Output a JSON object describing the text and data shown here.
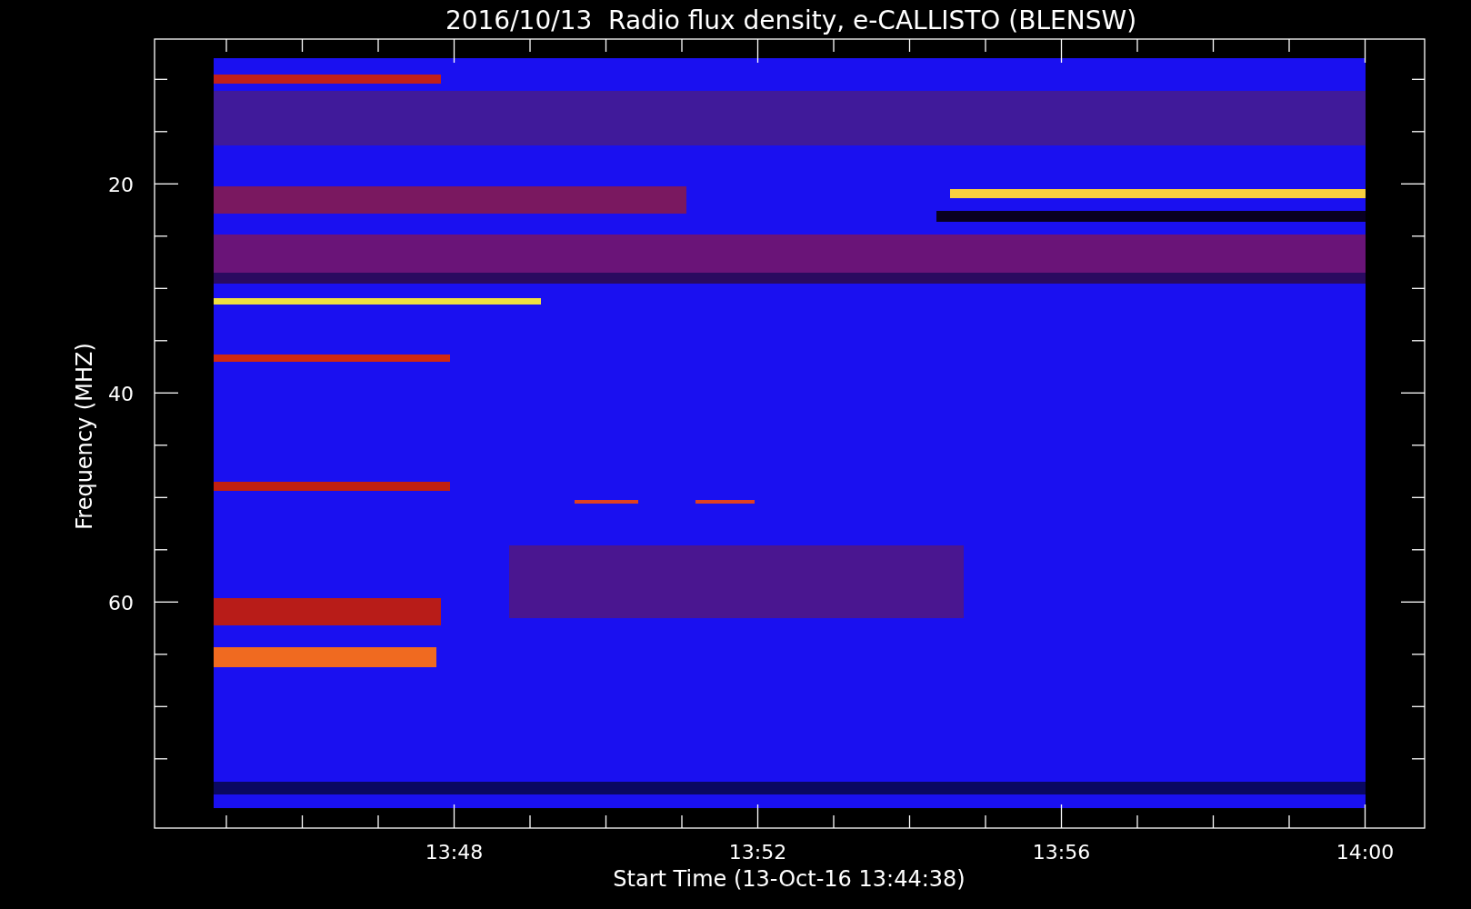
{
  "title": "2016/10/13  Radio flux density, e-CALLISTO (BLENSW)",
  "y_axis": {
    "label": "Frequency (MHZ)",
    "ticks": [
      "20",
      "40",
      "60"
    ]
  },
  "x_axis": {
    "label": "Start Time (13-Oct-16 13:44:38)",
    "ticks": [
      "13:48",
      "13:52",
      "13:56",
      "14:00"
    ]
  }
}
